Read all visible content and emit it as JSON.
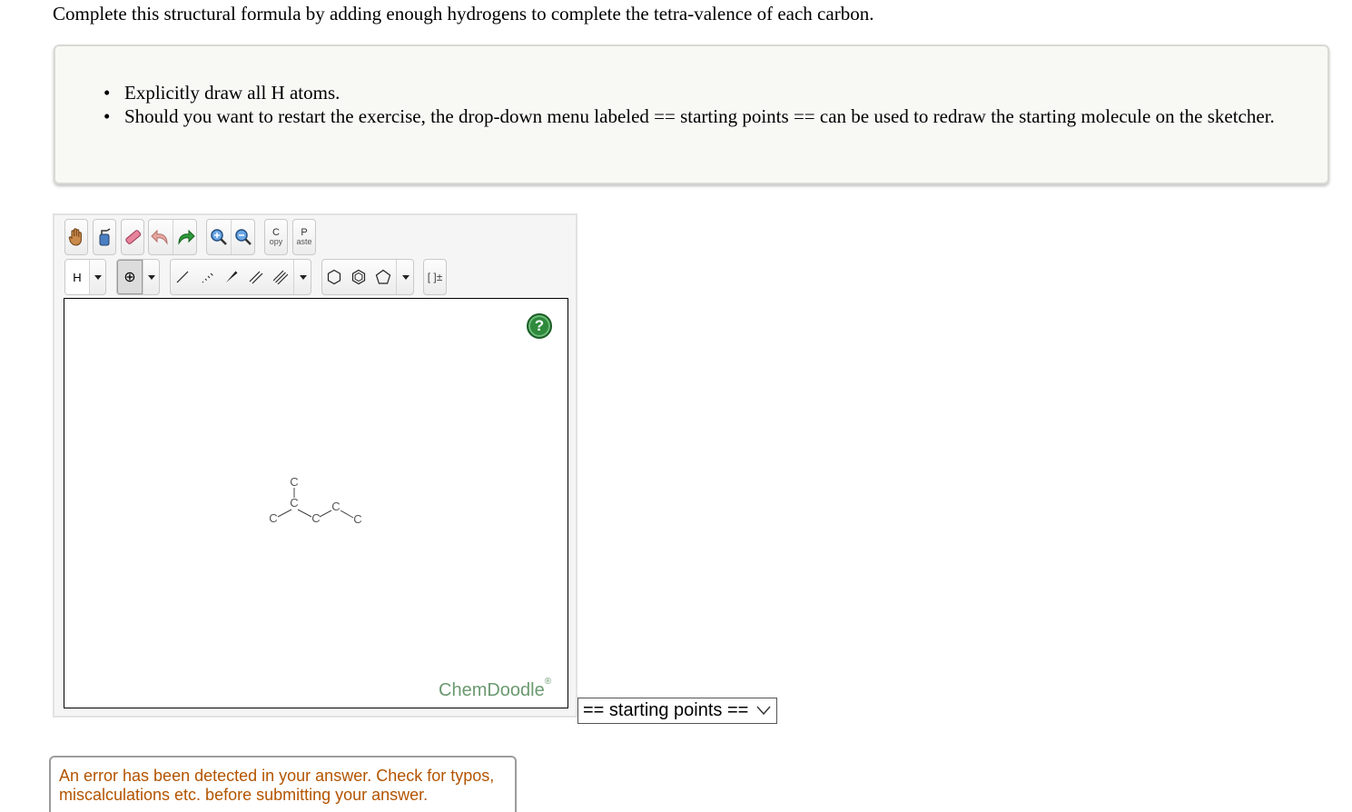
{
  "question": {
    "instruction": "Complete this structural formula by adding enough hydrogens to complete the tetra-valence of each carbon."
  },
  "notes": {
    "items": [
      "Explicitly draw all H atoms.",
      "Should you want to restart the exercise, the drop-down menu labeled == starting points == can be used to redraw the starting molecule on the sketcher."
    ]
  },
  "toolbar": {
    "top_row": [
      {
        "name": "pan-tool",
        "icon": "hand-icon"
      },
      {
        "name": "lasso-tool",
        "icon": "lasso-icon"
      },
      {
        "name": "eraser-tool",
        "icon": "eraser-icon"
      },
      {
        "name": "undo",
        "icon": "undo-arrow-icon"
      },
      {
        "name": "redo",
        "icon": "redo-arrow-icon"
      },
      {
        "name": "zoom-in",
        "icon": "zoom-in-icon"
      },
      {
        "name": "zoom-out",
        "icon": "zoom-out-icon"
      }
    ],
    "copy_label_big": "C",
    "copy_label_small": "opy",
    "paste_label_big": "P",
    "paste_label_small": "aste",
    "element_label": "H",
    "charge_label": "⊕",
    "bracket_label": "[ ]±"
  },
  "canvas": {
    "help_label": "?",
    "brand": "ChemDoodle",
    "brand_mark": "®",
    "atom_label": "C"
  },
  "starting_points": {
    "selected": "== starting points =="
  },
  "error": {
    "message": "An error has been detected in your answer. Check for typos, miscalculations etc. before submitting your answer."
  }
}
